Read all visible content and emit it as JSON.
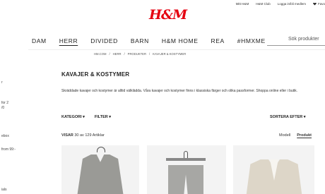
{
  "util": {
    "links": [
      "Mitt H&M",
      "H&M Club",
      "Logga in/bli medlem"
    ],
    "favorites": "Favo"
  },
  "logo": "H&M",
  "nav": {
    "items": [
      "DAM",
      "HERR",
      "DIVIDED",
      "BARN",
      "H&M HOME",
      "REA",
      "#HMXME"
    ],
    "active": "HERR"
  },
  "search": {
    "placeholder": "Sök produkter"
  },
  "breadcrumb": [
    "HM.COM",
    "/",
    "HERR",
    "/",
    "PRODUKTER",
    "/",
    "KAVAJER & KOSTYMER"
  ],
  "sidebar": {
    "fragments": [
      "r",
      "for 2",
      "/0",
      "ebox",
      "from 99:-",
      "ials"
    ]
  },
  "page": {
    "title": "KAVAJER & KOSTYMER",
    "description": "Skräddade kavajer och kostymer är alltid välklädda. Våra kavajer och kostymer finns i klassiska färger och olika passformer. Shoppa online eller i butik."
  },
  "filters": {
    "category": "KATEGORI ▾",
    "filter": "FILTER ▾",
    "sort": "SORTERA EFTER ▾"
  },
  "results": {
    "showing_label": "VISAR",
    "showing_value": "30 av 129 Artiklar"
  },
  "view": {
    "model": "Modell",
    "product": "Produkt",
    "active": "Produkt"
  },
  "products": [
    {
      "icon": "grey-jacket-image"
    },
    {
      "icon": "grey-trousers-image"
    },
    {
      "icon": "cream-jacket-image"
    }
  ],
  "colors": {
    "brand": "#e50010",
    "text": "#222222",
    "tile": "#f3f3f3"
  }
}
